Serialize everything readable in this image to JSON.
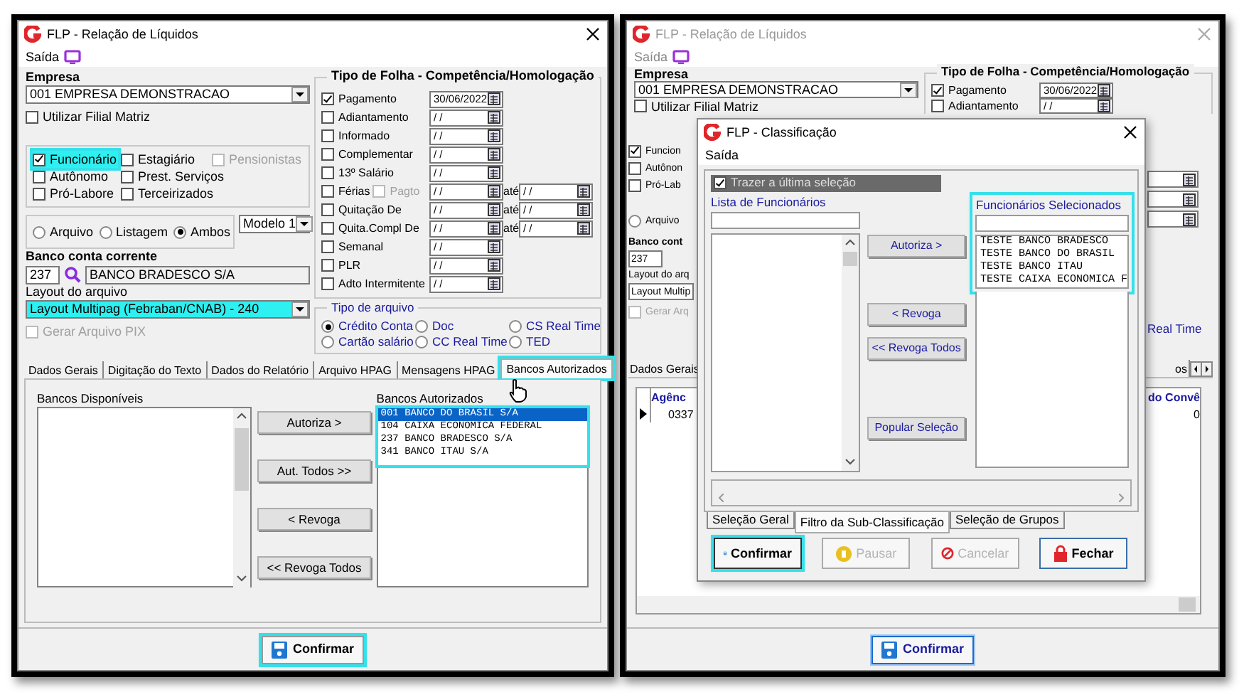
{
  "main_window": {
    "title": "FLP - Relação de Líquidos",
    "menu": [
      "Saída"
    ],
    "empresa": {
      "label": "Empresa",
      "value": "001 EMPRESA DEMONSTRACAO"
    },
    "filial": {
      "label": "Utilizar Filial Matriz",
      "checked": false
    },
    "category_rows": [
      [
        {
          "label": "Funcionário",
          "checked": true,
          "disabled": false,
          "highlighted": true
        },
        {
          "label": "Estagiário",
          "checked": false,
          "disabled": false,
          "highlighted": false
        },
        {
          "label": "Pensionistas",
          "checked": false,
          "disabled": true,
          "highlighted": false
        }
      ],
      [
        {
          "label": "Autônomo",
          "checked": false,
          "disabled": false,
          "highlighted": false
        },
        {
          "label": "Prest. Serviços",
          "checked": false,
          "disabled": false,
          "highlighted": false
        }
      ],
      [
        {
          "label": "Pró-Labore",
          "checked": false,
          "disabled": false,
          "highlighted": false
        },
        {
          "label": "Terceirizados",
          "checked": false,
          "disabled": false,
          "highlighted": false
        }
      ]
    ],
    "output": [
      {
        "label": "Arquivo",
        "selected": false
      },
      {
        "label": "Listagem",
        "selected": false
      },
      {
        "label": "Ambos",
        "selected": true
      }
    ],
    "modelo": "Modelo 1",
    "banco": {
      "label": "Banco conta corrente",
      "code": "237",
      "name": "BANCO BRADESCO S/A"
    },
    "layout": {
      "label": "Layout do arquivo",
      "value": "Layout Multipag (Febraban/CNAB) - 240",
      "highlighted": true
    },
    "pix": {
      "label": "Gerar Arquivo PIX",
      "checked": false,
      "disabled": true
    },
    "folha": {
      "title": "Tipo de Folha  -  Competência/Homologação",
      "rows": [
        {
          "label": "Pagamento",
          "checked": true,
          "date": "30/06/2022"
        },
        {
          "label": "Adiantamento",
          "checked": false,
          "date": "/ /"
        },
        {
          "label": "Informado",
          "checked": false,
          "date": "/ /"
        },
        {
          "label": "Complementar",
          "checked": false,
          "date": "/ /"
        },
        {
          "label": "13º Salário",
          "checked": false,
          "date": "/ /"
        },
        {
          "label": "Férias",
          "checked": false,
          "date": "/ /",
          "extra": {
            "label": "Pagto",
            "checked": false,
            "disabled": true
          },
          "until": {
            "label": "até",
            "date": "/ /"
          }
        },
        {
          "label": "Quitação De",
          "checked": false,
          "date": "/ /",
          "until": {
            "label": "até",
            "date": "/ /"
          }
        },
        {
          "label": "Quita.Compl De",
          "checked": false,
          "date": "/ /",
          "until": {
            "label": "até",
            "date": "/ /"
          }
        },
        {
          "label": "Semanal",
          "checked": false,
          "date": "/ /"
        },
        {
          "label": "PLR",
          "checked": false,
          "date": "/ /"
        },
        {
          "label": "Adto Intermitente",
          "checked": false,
          "date": "/ /"
        }
      ]
    },
    "tipo_arquivo": {
      "title": "Tipo de arquivo",
      "options": [
        {
          "label": "Crédito Conta",
          "selected": true
        },
        {
          "label": "Doc",
          "selected": false
        },
        {
          "label": "CS Real Time",
          "selected": false
        },
        {
          "label": "Cartão salário",
          "selected": false
        },
        {
          "label": "CC Real Time",
          "selected": false
        },
        {
          "label": "TED",
          "selected": false
        }
      ]
    },
    "tabs": [
      {
        "label": "Dados Gerais",
        "selected": false,
        "highlighted": false
      },
      {
        "label": "Digitação do Texto",
        "selected": false,
        "highlighted": false
      },
      {
        "label": "Dados do Relatório",
        "selected": false,
        "highlighted": false
      },
      {
        "label": "Arquivo HPAG",
        "selected": false,
        "highlighted": false
      },
      {
        "label": "Mensagens HPAG",
        "selected": false,
        "highlighted": false
      },
      {
        "label": "Bancos Autorizados",
        "selected": true,
        "highlighted": true
      }
    ],
    "panel": {
      "available_label": "Bancos Disponíveis",
      "buttons": [
        "Autoriza >",
        "Aut. Todos >>",
        "< Revoga",
        "<< Revoga Todos"
      ],
      "authorized_label": "Bancos Autorizados",
      "authorized_highlighted": true,
      "authorized": [
        {
          "label": "001 BANCO DO BRASIL S/A",
          "selected": true
        },
        {
          "label": "104 CAIXA ECONOMICA FEDERAL",
          "selected": false
        },
        {
          "label": "237 BANCO BRADESCO S/A",
          "selected": false
        },
        {
          "label": "341 BANCO ITAU S/A",
          "selected": false
        }
      ]
    },
    "confirm": {
      "label": "Confirmar",
      "highlighted": true
    }
  },
  "background_window": {
    "title": "FLP - Relação de Líquidos",
    "menu": [
      "Saída"
    ],
    "empresa": {
      "label": "Empresa",
      "value": "001 EMPRESA DEMONSTRACAO"
    },
    "filial": {
      "label": "Utilizar Filial Matriz",
      "checked": false
    },
    "folha": {
      "title": "Tipo de Folha  -  Competência/Homologação",
      "rows": [
        {
          "label": "Pagamento",
          "checked": true,
          "date": "30/06/2022"
        },
        {
          "label": "Adiantamento",
          "checked": false,
          "date": "/ /"
        }
      ]
    },
    "left_fragments": [
      {
        "kind": "checkbox",
        "label": "Funcion",
        "checked": true
      },
      {
        "kind": "checkbox",
        "label": "Autônon",
        "checked": false
      },
      {
        "kind": "checkbox",
        "label": "Pró-Lab",
        "checked": false
      },
      {
        "kind": "radio",
        "label": "Arquivo",
        "selected": false
      },
      {
        "kind": "heading",
        "label": "Banco cont"
      },
      {
        "kind": "code",
        "label": "237"
      },
      {
        "kind": "label",
        "label": "Layout do arq"
      },
      {
        "kind": "select",
        "label": "Layout Multip"
      },
      {
        "kind": "checkbox",
        "label": "Gerar Arq",
        "checked": false,
        "disabled": true
      }
    ],
    "right_text": "Real Time",
    "tabs": [
      {
        "label": "Dados Gerais",
        "selected": false
      },
      {
        "label": "os",
        "selected": false
      }
    ],
    "table": {
      "columns": [
        "Agênc",
        "do Convê"
      ],
      "rows": [
        [
          "0337",
          "0"
        ]
      ]
    },
    "confirm": {
      "label": "Confirmar"
    }
  },
  "dialog": {
    "title": "FLP - Classificação",
    "menu": [
      "Saída"
    ],
    "keep_last": {
      "label": "Trazer a última seleção",
      "checked": true
    },
    "list_label": "Lista de Funcionários",
    "buttons": [
      "Autoriza >",
      "< Revoga",
      "<< Revoga Todos",
      "Popular Seleção"
    ],
    "selected_label": "Funcionários Selecionados",
    "selected_highlighted": true,
    "selected_items": [
      "TESTE BANCO BRADESCO",
      "TESTE BANCO DO BRASIL",
      "TESTE BANCO ITAU",
      "TESTE CAIXA ECONOMICA F"
    ],
    "tabs": [
      {
        "label": "Seleção Geral",
        "selected": false
      },
      {
        "label": "Filtro da Sub-Classificação",
        "selected": true
      },
      {
        "label": "Seleção de Grupos",
        "selected": false
      }
    ],
    "actions": [
      {
        "label": "Confirmar",
        "kind": "confirm",
        "disabled": false,
        "highlighted": true
      },
      {
        "label": "Pausar",
        "kind": "pause",
        "disabled": true,
        "highlighted": false
      },
      {
        "label": "Cancelar",
        "kind": "cancel",
        "disabled": true,
        "highlighted": false
      },
      {
        "label": "Fechar",
        "kind": "close",
        "disabled": false,
        "highlighted": false
      }
    ]
  }
}
